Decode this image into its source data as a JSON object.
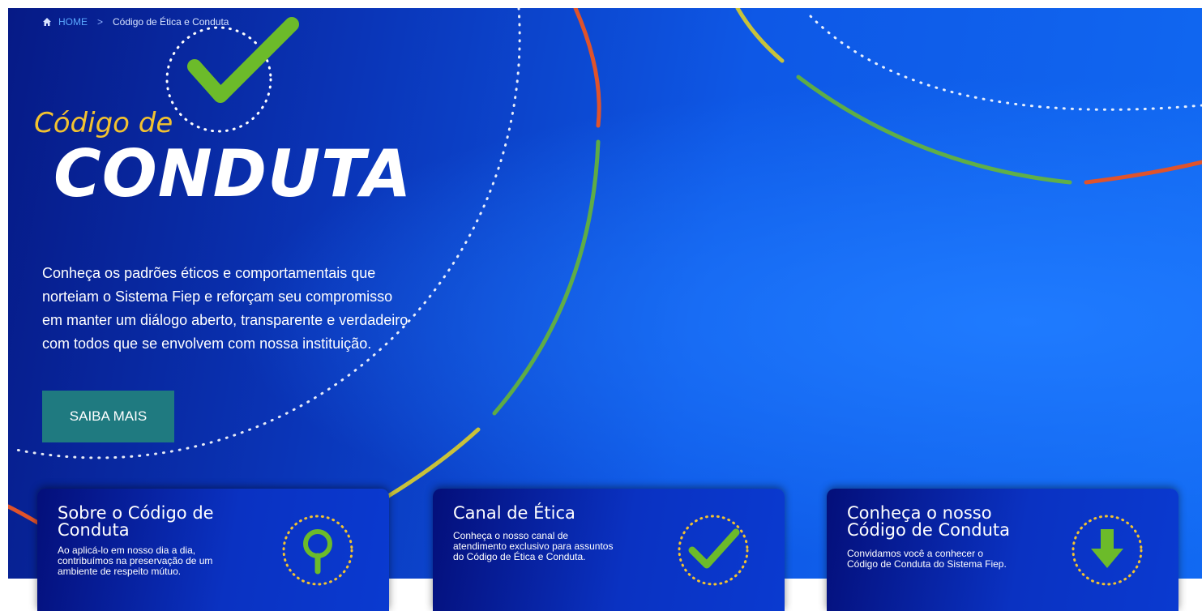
{
  "breadcrumb": {
    "home_label": "HOME",
    "separator": ">",
    "current": "Código de Ética e Conduta"
  },
  "hero": {
    "title_line1": "Código de",
    "title_line2": "CONDUTA",
    "intro_text": "Conheça os padrões éticos e comportamentais que norteiam o Sistema Fiep e reforçam seu compromisso em manter um diálogo aberto, transparente e verdadeiro com todos que se envolvem com nossa instituição.",
    "cta_label": "SAIBA MAIS",
    "icon": "checkmark-icon"
  },
  "cards": [
    {
      "title": "Sobre o Código de Conduta",
      "text": "Ao aplicá-lo em nosso dia a dia, contribuímos na preservação de um ambiente de respeito mútuo.",
      "icon": "magnifier-icon"
    },
    {
      "title": "Canal de Ética",
      "text": "Conheça o nosso canal de atendimento exclusivo para assuntos do Código de Ética e Conduta.",
      "icon": "checkmark-icon"
    },
    {
      "title": "Conheça o nosso Código de Conduta",
      "text": "Convidamos você a conhecer o Código de Conduta do Sistema Fiep.",
      "icon": "download-arrow-icon"
    }
  ],
  "colors": {
    "accent_green": "#6cbb2a",
    "accent_yellow": "#f2c230",
    "accent_orange": "#e0532b",
    "button_teal": "#1f7a80",
    "hero_blue": "#0e58e6"
  }
}
